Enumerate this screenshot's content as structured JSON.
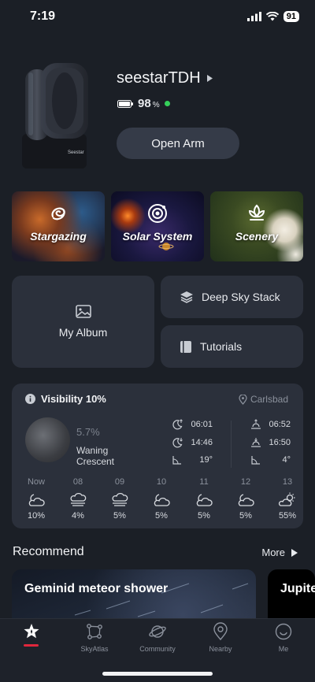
{
  "status_bar": {
    "time": "7:19",
    "battery": "91"
  },
  "device": {
    "name": "seestarTDH",
    "battery_value": "98",
    "battery_unit": "%",
    "open_arm_label": "Open Arm",
    "brand_mark": "Seestar"
  },
  "modes": [
    {
      "label": "Stargazing",
      "icon": "galaxy-icon"
    },
    {
      "label": "Solar System",
      "icon": "orbit-icon"
    },
    {
      "label": "Scenery",
      "icon": "lotus-icon"
    }
  ],
  "shortcuts": {
    "album": "My Album",
    "deep_sky": "Deep Sky Stack",
    "tutorials": "Tutorials"
  },
  "visibility": {
    "title": "Visibility 10%",
    "location": "Carlsbad",
    "moon_illumination": "5.7%",
    "moon_phase": "Waning Crescent",
    "moonrise": "06:01",
    "moonset": "14:46",
    "moon_altitude": "19°",
    "sunrise": "06:52",
    "sunset": "16:50",
    "sun_altitude": "4°",
    "forecast": [
      {
        "time": "Now",
        "value": "10%",
        "icon": "partly-cloudy-night-icon"
      },
      {
        "time": "08",
        "value": "4%",
        "icon": "fog-icon"
      },
      {
        "time": "09",
        "value": "5%",
        "icon": "fog-icon"
      },
      {
        "time": "10",
        "value": "5%",
        "icon": "partly-cloudy-night-icon"
      },
      {
        "time": "11",
        "value": "5%",
        "icon": "partly-cloudy-night-icon"
      },
      {
        "time": "12",
        "value": "5%",
        "icon": "partly-cloudy-night-icon"
      },
      {
        "time": "13",
        "value": "55%",
        "icon": "partly-sunny-icon"
      }
    ]
  },
  "recommend": {
    "title": "Recommend",
    "more": "More",
    "cards": [
      "Geminid meteor shower",
      "Jupite"
    ]
  },
  "tabs": [
    {
      "label": "",
      "icon": "home-star-icon",
      "active": true
    },
    {
      "label": "SkyAtlas",
      "icon": "constellation-icon"
    },
    {
      "label": "Community",
      "icon": "planet-icon"
    },
    {
      "label": "Nearby",
      "icon": "location-pin-icon"
    },
    {
      "label": "Me",
      "icon": "smile-icon"
    }
  ],
  "colors": {
    "background": "#1b1f26",
    "card": "#2b303b",
    "accent_red": "#e0273c",
    "online_green": "#35d05a"
  }
}
